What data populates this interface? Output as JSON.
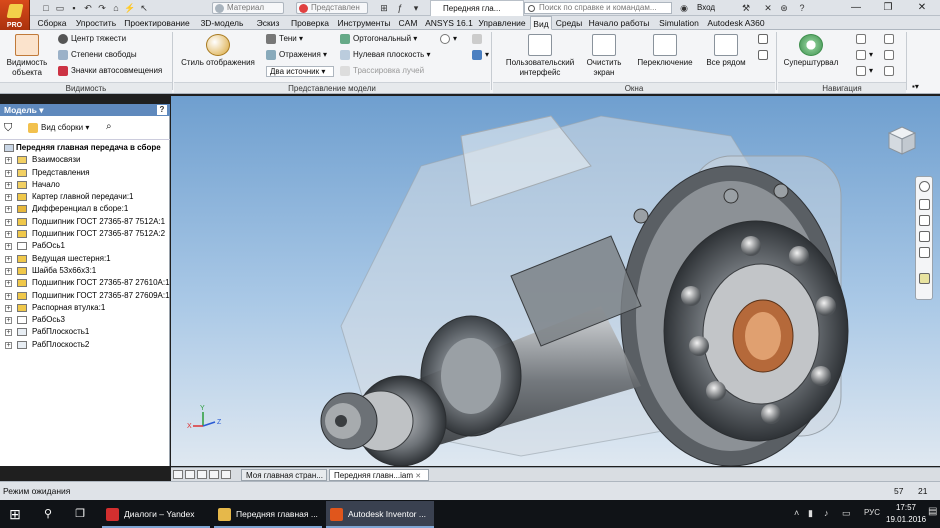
{
  "titlebar": {
    "pro_label": "PRO",
    "material_placeholder": "Материал",
    "representation_placeholder": "Представлен",
    "doc_title": "Передняя гла...",
    "search_placeholder": "Поиск по справке и командам...",
    "login_label": "Вход",
    "help_icon": "?"
  },
  "tabs": [
    "Сборка",
    "Упростить",
    "Проектирование",
    "3D-модель",
    "Эскиз",
    "Проверка",
    "Инструменты",
    "CAM",
    "ANSYS 16.1",
    "Управление",
    "Вид",
    "Среды",
    "Начало работы",
    "Simulation",
    "Autodesk A360"
  ],
  "active_tab": "Вид",
  "ribbon": {
    "visibility": {
      "title": "Видимость",
      "object_visibility": "Видимость объекта",
      "center_of_gravity": "Центр тяжести",
      "degrees_of_freedom": "Степени свободы",
      "motion_icons": "Значки автосовмещения"
    },
    "model_view": {
      "title": "Представление модели",
      "visual_style": "Стиль отображения",
      "shadows": "Тени",
      "reflections": "Отражения",
      "orthographic": "Ортогональный",
      "ground_plane": "Нулевая плоскость",
      "light_source": "Два источник",
      "ray_tracing": "Трассировка лучей"
    },
    "window": {
      "title": "Окна",
      "user_interface": "Пользовательский интерфейс",
      "clean_screen": "Очистить экран",
      "switch": "Переключение",
      "arrange_all": "Все рядом"
    },
    "navigation": {
      "title": "Навигация",
      "steering_wheels": "Суперштурвал"
    }
  },
  "browser": {
    "title": "Модель",
    "assembly_view": "Вид сборки",
    "root": "Передняя главная передача в сборе",
    "nodes": [
      {
        "label": "Взаимосвязи",
        "kind": "folder"
      },
      {
        "label": "Представления",
        "kind": "folder"
      },
      {
        "label": "Начало",
        "kind": "folder"
      },
      {
        "label": "Картер главной передачи:1",
        "kind": "part"
      },
      {
        "label": "Дифференциал в сборе:1",
        "kind": "asm"
      },
      {
        "label": "Подшипник ГОСТ 27365-87 7512А:1",
        "kind": "part"
      },
      {
        "label": "Подшипник ГОСТ 27365-87 7512А:2",
        "kind": "part"
      },
      {
        "label": "РабОсь1",
        "kind": "axis"
      },
      {
        "label": "Ведущая шестерня:1",
        "kind": "part"
      },
      {
        "label": "Шайба 53х66х3:1",
        "kind": "part"
      },
      {
        "label": "Подшипник ГОСТ 27365-87 27610А:1",
        "kind": "part"
      },
      {
        "label": "Подшипник ГОСТ 27365-87 27609А:1",
        "kind": "part"
      },
      {
        "label": "Распорная втулка:1",
        "kind": "part"
      },
      {
        "label": "РабОсь3",
        "kind": "axis"
      },
      {
        "label": "РабПлоскость1",
        "kind": "plane"
      },
      {
        "label": "РабПлоскость2",
        "kind": "plane"
      }
    ]
  },
  "doc_tabs": [
    "Моя главная стран...",
    "Передняя главн...iam"
  ],
  "active_doc_tab": 1,
  "status": {
    "text": "Режим ожидания",
    "n1": "57",
    "n2": "21"
  },
  "taskbar": {
    "items": [
      {
        "label": "Диалоги – Yandex",
        "color": "#d32f2f"
      },
      {
        "label": "Передняя главная ...",
        "color": "#e6b84a"
      },
      {
        "label": "Autodesk Inventor ...",
        "color": "#e0561c"
      }
    ],
    "lang": "РУС",
    "time": "17:57",
    "date": "19.01.2016"
  },
  "colors": {
    "accent": "#5f89bd",
    "pro": "#c9421a"
  }
}
